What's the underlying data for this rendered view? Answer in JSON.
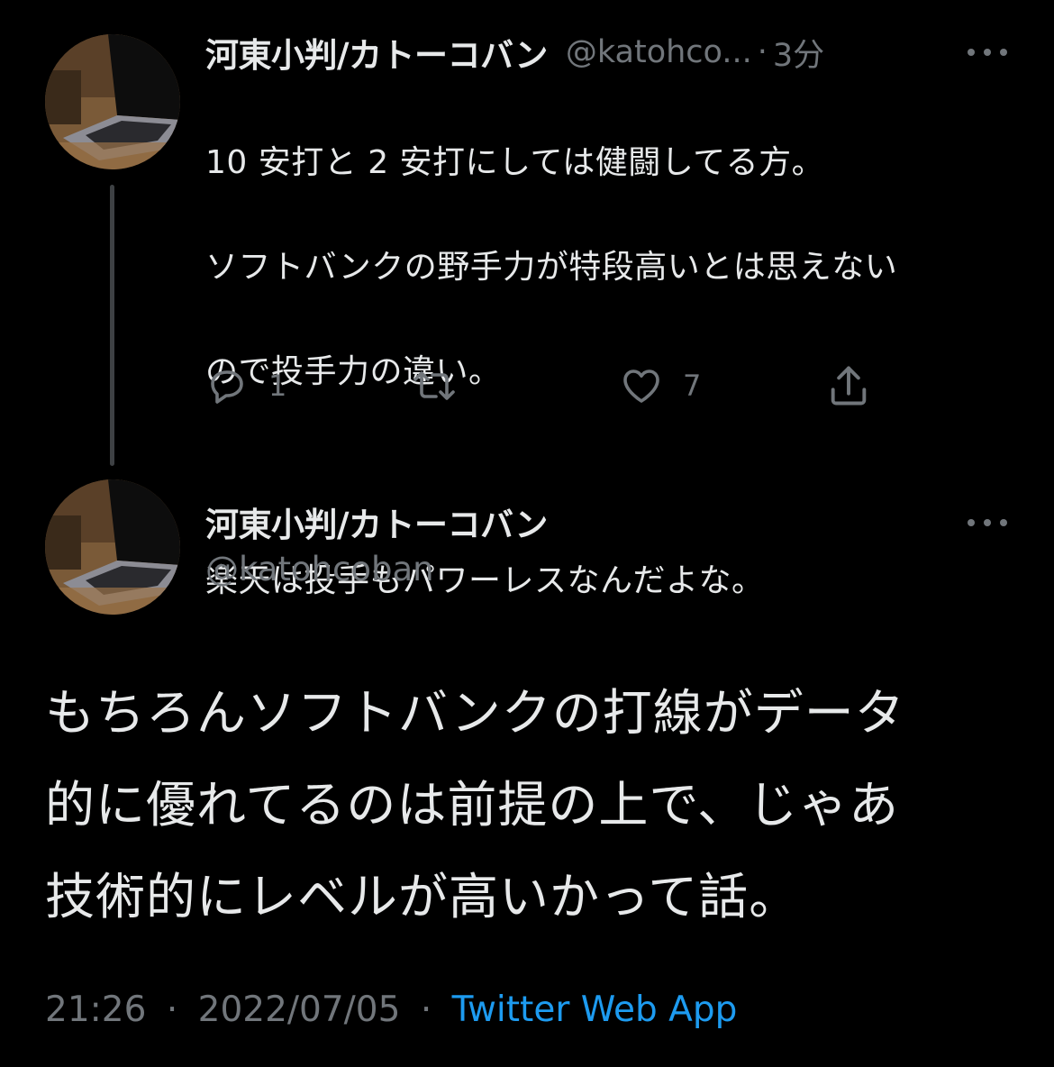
{
  "reply_tweet": {
    "author_name": "河東小判/カトーコバン",
    "handle": "@katohco...",
    "separator": "·",
    "time_ago": "3分",
    "text_lines": [
      "10 安打と 2 安打にしては健闘してる方。",
      "ソフトバンクの野手力が特段高いとは思えない",
      "ので投手力の違い。",
      "楽天は投手もパワーレスなんだよな。"
    ],
    "actions": {
      "reply_count": "1",
      "retweet_count": "",
      "like_count": "7"
    }
  },
  "main_tweet": {
    "author_name": "河東小判/カトーコバン",
    "handle": "@katohcoban",
    "text_lines": [
      "もちろんソフトバンクの打線がデータ",
      "的に優れてるのは前提の上で、じゃあ",
      "技術的にレベルが高いかって話。"
    ],
    "time": "21:26",
    "separator": "·",
    "date": "2022/07/05",
    "source": "Twitter Web App"
  },
  "icons": {
    "reply": "reply-icon",
    "retweet": "retweet-icon",
    "like": "heart-icon",
    "share": "share-icon",
    "more": "more-horizontal-icon"
  },
  "colors": {
    "background": "#000000",
    "text_primary": "#e7e9ea",
    "text_secondary": "#71767b",
    "link": "#1d9bf0",
    "thread_line": "#3e4144"
  }
}
